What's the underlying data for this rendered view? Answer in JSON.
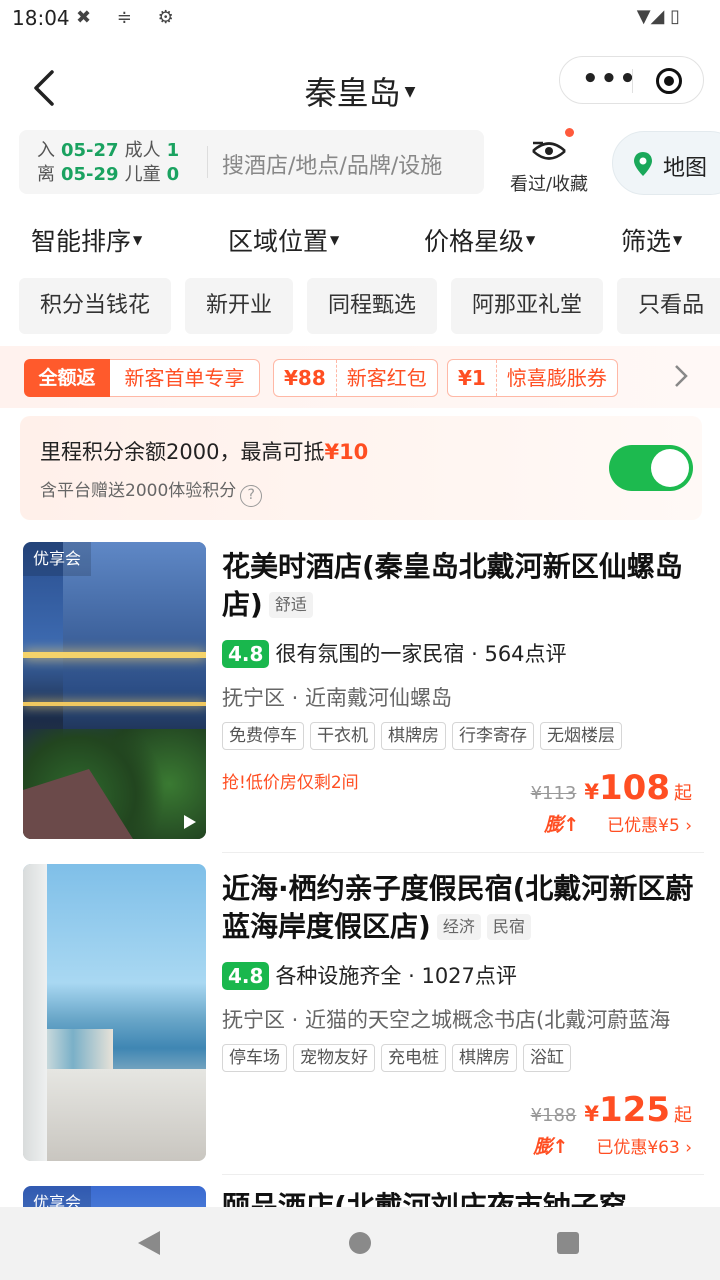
{
  "status": {
    "time": "18:04"
  },
  "header": {
    "city": "秦皇岛"
  },
  "search": {
    "checkin_label": "入",
    "checkin_date": "05-27",
    "checkout_label": "离",
    "checkout_date": "05-29",
    "adults_label": "成人",
    "adults": "1",
    "children_label": "儿童",
    "children": "0",
    "placeholder": "搜酒店/地点/品牌/设施",
    "viewed_label": "看过/收藏",
    "map_label": "地图"
  },
  "sort": [
    "智能排序",
    "区域位置",
    "价格星级",
    "筛选"
  ],
  "quick_tags": [
    "积分当钱花",
    "新开业",
    "同程甄选",
    "阿那亚礼堂",
    "只看品"
  ],
  "promo": {
    "full_label": "全额返",
    "first_label": "新客首单专享",
    "coupons": [
      {
        "amount": "¥88",
        "name": "新客红包"
      },
      {
        "amount": "¥1",
        "name": "惊喜膨胀券"
      }
    ]
  },
  "points": {
    "line1_prefix": "里程积分余额2000，最高可抵",
    "line1_amount": "¥10",
    "line2": "含平台赠送2000体验积分",
    "toggle_on": true
  },
  "hotels": [
    {
      "badge": "优享会",
      "name": "花美时酒店(秦皇岛北戴河新区仙螺岛店)",
      "level": [
        "舒适"
      ],
      "score": "4.8",
      "tagline": "很有氛围的一家民宿 · 564点评",
      "location": "抚宁区 · 近南戴河仙螺岛",
      "amenities": [
        "免费停车",
        "干衣机",
        "棋牌房",
        "行李寄存",
        "无烟楼层"
      ],
      "urgency": "抢!低价房仅剩2间",
      "old_price": "¥113",
      "currency": "¥",
      "price": "108",
      "price_suffix": "起",
      "boost_label": "膨↑",
      "discount": "已优惠¥5"
    },
    {
      "badge": "",
      "name": "近海·栖约亲子度假民宿(北戴河新区蔚蓝海岸度假区店)",
      "level": [
        "经济",
        "民宿"
      ],
      "score": "4.8",
      "tagline": "各种设施齐全 · 1027点评",
      "location": "抚宁区 · 近猫的天空之城概念书店(北戴河蔚蓝海",
      "amenities": [
        "停车场",
        "宠物友好",
        "充电桩",
        "棋牌房",
        "浴缸"
      ],
      "urgency": "",
      "old_price": "¥188",
      "currency": "¥",
      "price": "125",
      "price_suffix": "起",
      "boost_label": "膨↑",
      "discount": "已优惠¥63"
    },
    {
      "badge": "优享会",
      "name": "颐品酒店(北戴河刘庄夜市钟子窑"
    }
  ],
  "colors": {
    "accent": "#ff4e22",
    "green": "#1dba4f",
    "score": "#19b74d"
  }
}
